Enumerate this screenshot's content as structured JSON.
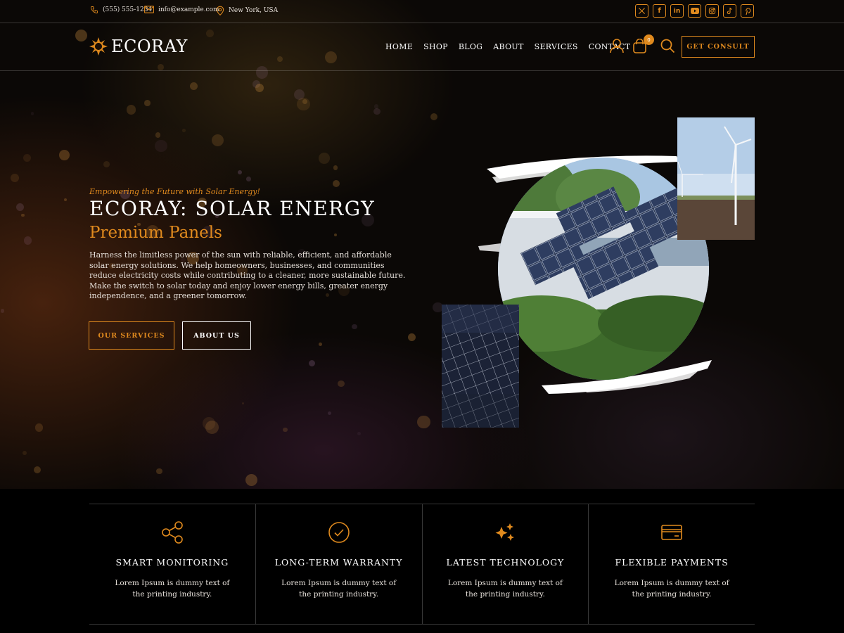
{
  "topbar": {
    "phone": "(555) 555-1234",
    "email": "info@example.com",
    "location": "New York, USA",
    "socials": [
      "x-icon",
      "facebook-icon",
      "linkedin-icon",
      "youtube-icon",
      "instagram-icon",
      "tiktok-icon",
      "pinterest-icon"
    ]
  },
  "header": {
    "logo": "ECORAY",
    "menu": [
      "HOME",
      "SHOP",
      "BLOG",
      "ABOUT",
      "SERVICES",
      "CONTACT"
    ],
    "cart_count": "0",
    "cta": "GET CONSULT"
  },
  "hero": {
    "tagline": "Empowering the Future with Solar Energy!",
    "title": "ECORAY: SOLAR ENERGY",
    "subtitle": "Premium Panels",
    "description": "Harness the limitless power of the sun with reliable, efficient, and affordable solar energy solutions. We help homeowners, businesses, and communities reduce electricity costs while contributing to a cleaner, more sustainable future. Make the switch to solar today and enjoy lower energy bills, greater energy independence, and a greener tomorrow.",
    "buttons": {
      "services": "OUR SERVICES",
      "about": "ABOUT US"
    }
  },
  "features": [
    {
      "icon": "share-icon",
      "title": "SMART MONITORING",
      "desc": "Lorem Ipsum is dummy text of the printing industry."
    },
    {
      "icon": "check-circle-icon",
      "title": "LONG-TERM WARRANTY",
      "desc": "Lorem Ipsum is dummy text of the printing industry."
    },
    {
      "icon": "sparkles-icon",
      "title": "LATEST TECHNOLOGY",
      "desc": "Lorem Ipsum is dummy text of the printing industry."
    },
    {
      "icon": "credit-card-icon",
      "title": "FLEXIBLE PAYMENTS",
      "desc": "Lorem Ipsum is dummy text of the printing industry."
    }
  ],
  "colors": {
    "accent": "#e08a1e",
    "background": "#000000"
  }
}
